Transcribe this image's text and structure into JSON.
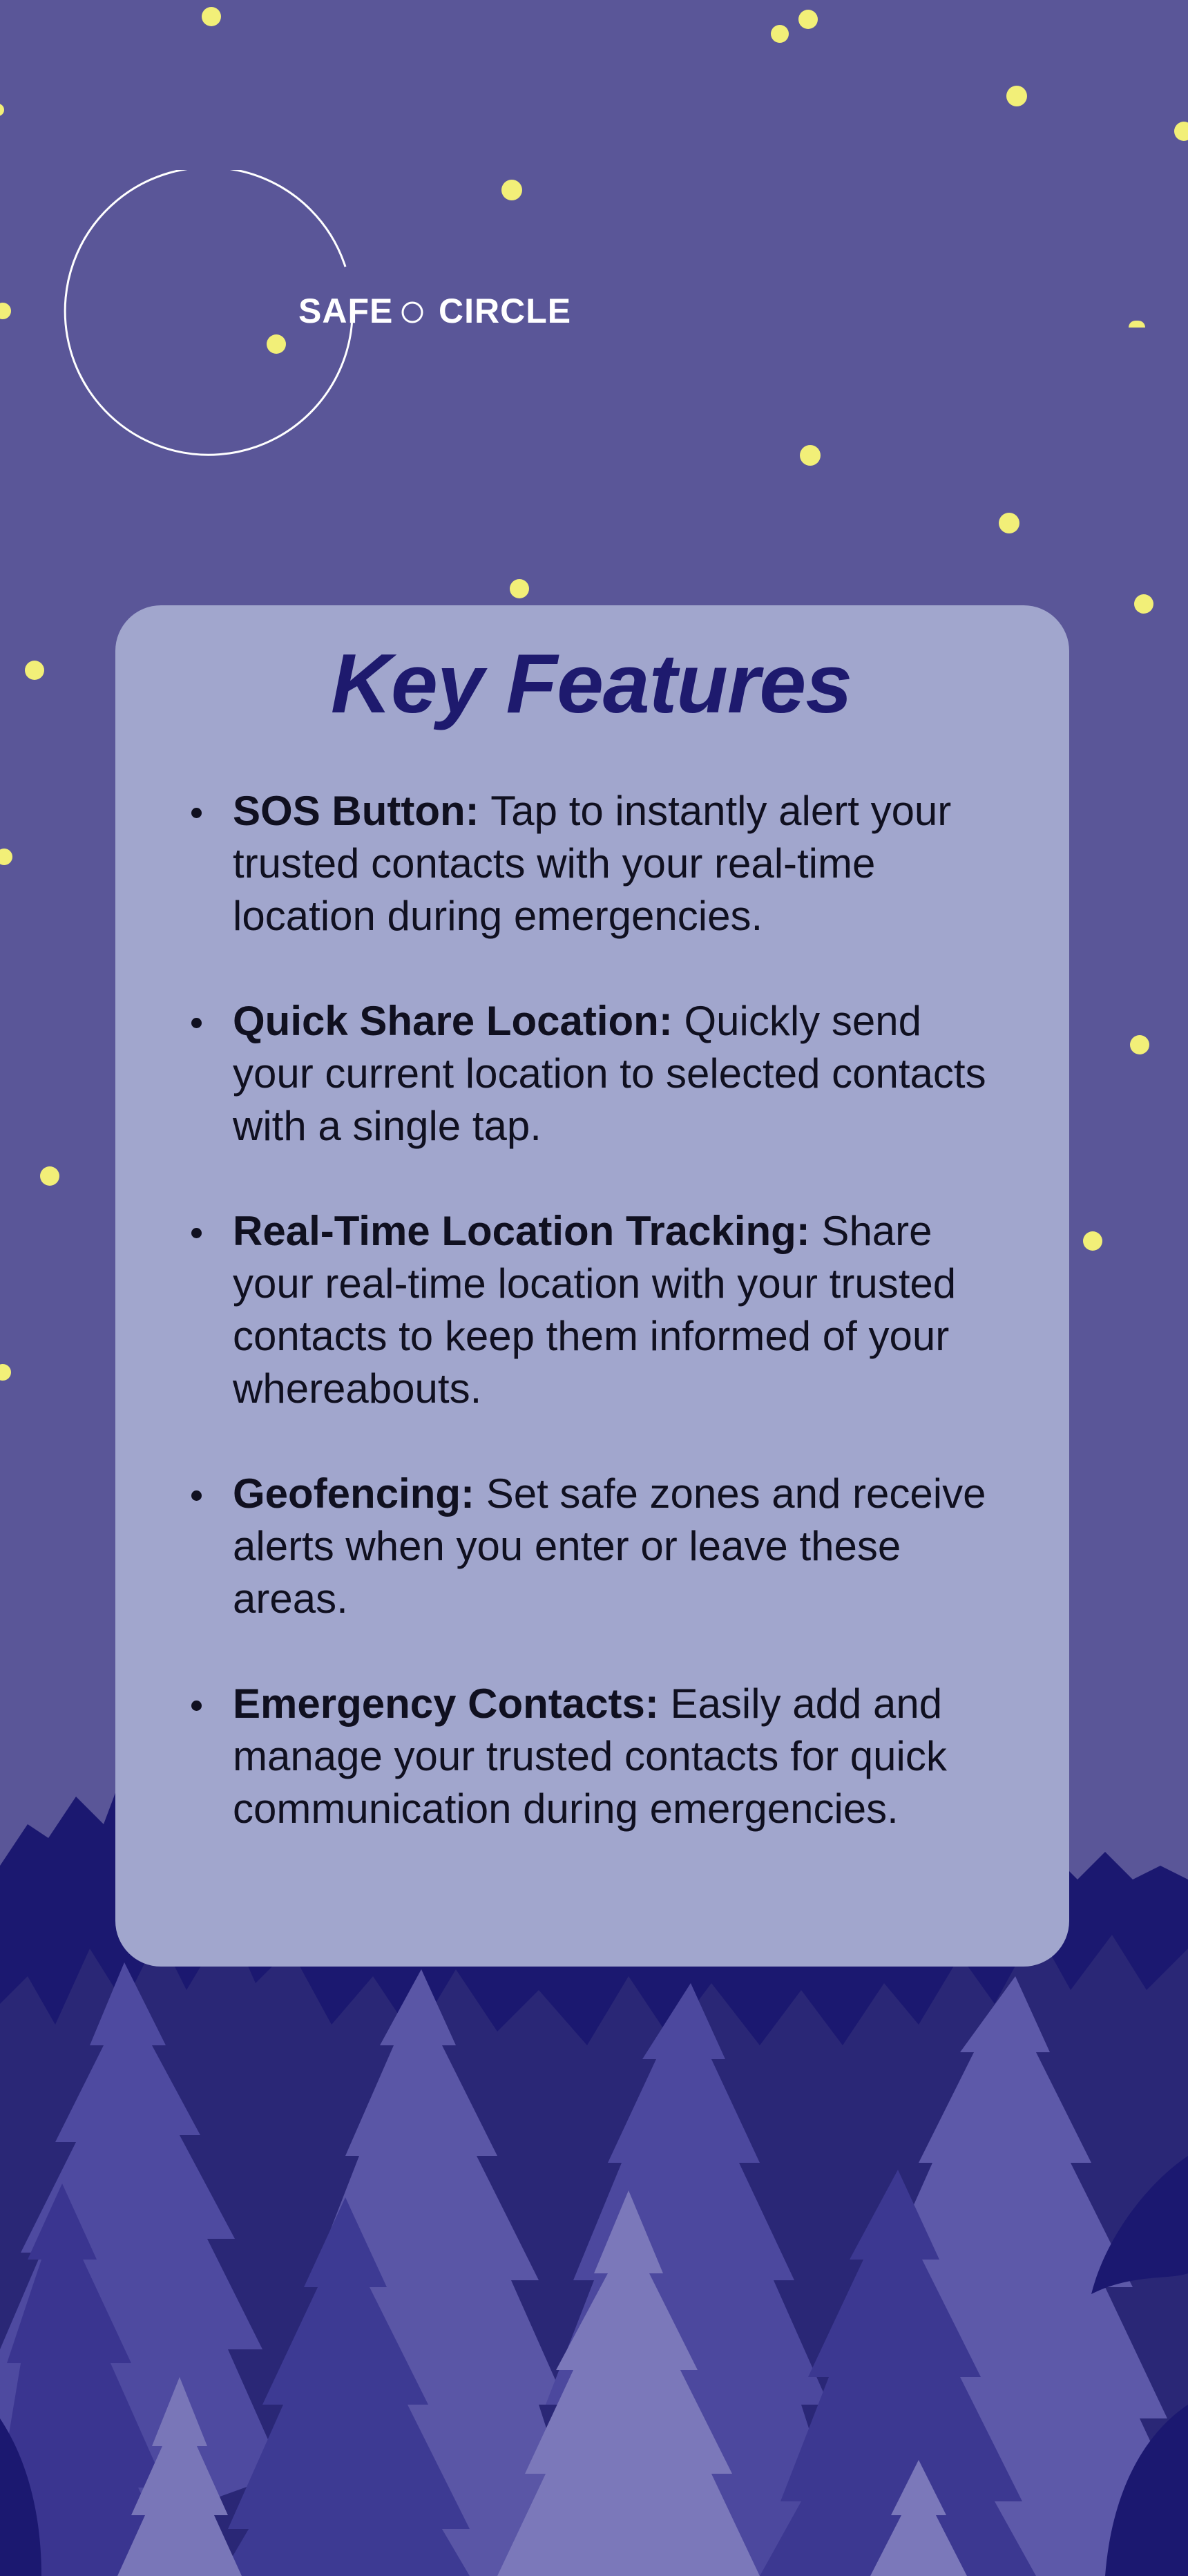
{
  "palette": {
    "sky": "#5a5698",
    "star": "#f2ef78",
    "card": "#a1a6cd",
    "title": "#1e1a6e",
    "text": "#101020",
    "logo": "#ffffff"
  },
  "brand": {
    "name_part_1": "SAFE",
    "name_part_2": "CIRCLE"
  },
  "features": {
    "title": "Key Features",
    "items": [
      {
        "name": "SOS Button:",
        "description": "Tap to instantly alert your trusted contacts with your real-time location during emergencies."
      },
      {
        "name": "Quick Share Location:",
        "description": "Quickly send your current location to selected contacts with a single tap."
      },
      {
        "name": "Real-Time Location Tracking:",
        "description": "Share your real-time location with your trusted contacts to keep them informed of your whereabouts."
      },
      {
        "name": "Geofencing:",
        "description": "Set safe zones and receive alerts when you enter or leave these areas."
      },
      {
        "name": "Emergency Contacts:",
        "description": "Easily add and manage your trusted contacts for quick communication during emergencies."
      }
    ]
  }
}
